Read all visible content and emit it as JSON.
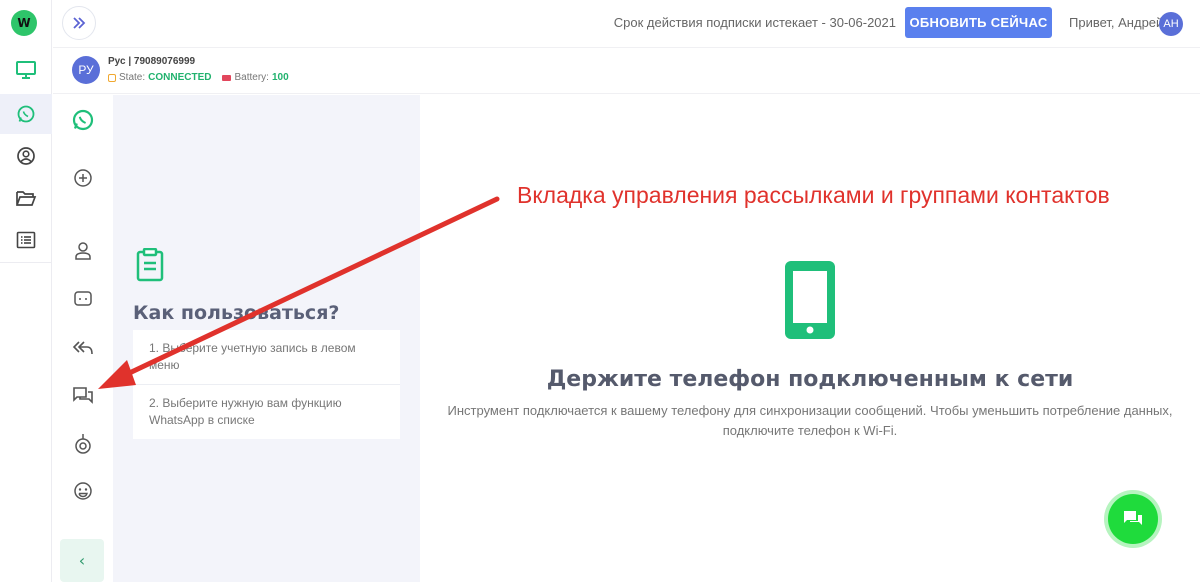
{
  "app": {
    "logo_letter": "W"
  },
  "rail": {
    "items": [
      {
        "name": "monitor",
        "icon": "monitor-icon",
        "active": false
      },
      {
        "name": "whatsapp",
        "icon": "whatsapp-icon",
        "active": true
      },
      {
        "name": "profile",
        "icon": "user-circle-icon",
        "active": false
      },
      {
        "name": "folder",
        "icon": "folder-open-icon",
        "active": false
      },
      {
        "name": "list",
        "icon": "list-icon",
        "active": false
      }
    ]
  },
  "header": {
    "subscription_text": "Срок действия подписки истекает - 30-06-2021",
    "renew_button": "ОБНОВИТЬ СЕЙЧАС",
    "greeting": "Привет, Андрей",
    "user_initials": "АН"
  },
  "account": {
    "initials": "РУ",
    "name": "Рус | 79089076999",
    "state_label": "State:",
    "state_value": "CONNECTED",
    "battery_label": "Battery:",
    "battery_value": "100"
  },
  "tools": {
    "items": [
      "whatsapp-icon",
      "add-circle-icon",
      "contact-icon",
      "chat-bubble-icon",
      "reply-all-icon",
      "messages-icon",
      "broadcast-icon",
      "emoji-icon"
    ],
    "collapse_glyph": "‹"
  },
  "panel": {
    "title": "Как пользоваться?",
    "steps": [
      "1. Выберите учетную запись в левом меню",
      "2. Выберите нужную вам функцию WhatsApp в списке"
    ]
  },
  "main": {
    "annotation": "Вкладка управления рассылками и группами контактов",
    "title": "Держите телефон подключенным к сети",
    "description": "Инструмент подключается к вашему телефону для синхронизации сообщений. Чтобы уменьшить потребление данных, подключите телефон к Wi-Fi."
  },
  "colors": {
    "accent_green": "#1fbf7a",
    "button_blue": "#5a80ee",
    "annotation_red": "#e0322c",
    "fab_green": "#1fdb3c"
  }
}
